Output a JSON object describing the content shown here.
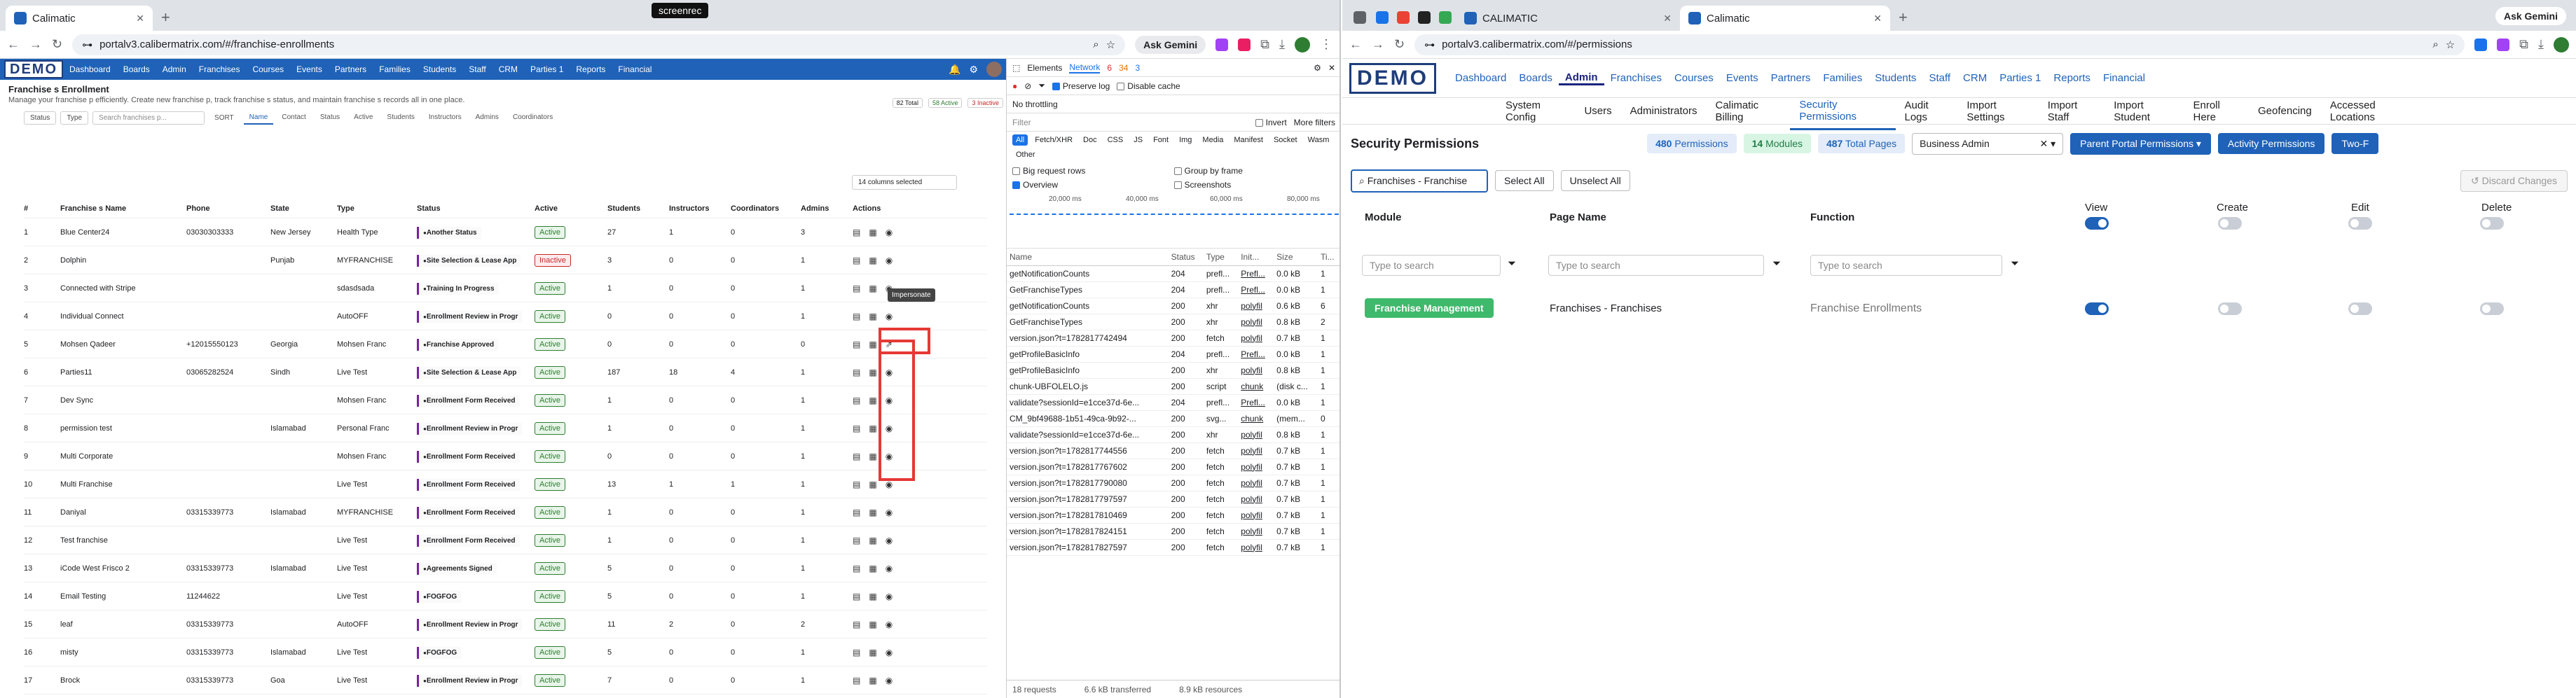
{
  "left": {
    "tab_title": "Calimatic",
    "recorder": "screenrec",
    "url": "portalv3.calibermatrix.com/#/franchise-enrollments",
    "ask_gemini": "Ask Gemini",
    "app": {
      "logo": "DEMO",
      "nav": [
        "Dashboard",
        "Boards",
        "Admin",
        "Franchises",
        "Courses",
        "Events",
        "Partners",
        "Families",
        "Students",
        "Staff",
        "CRM",
        "Parties 1",
        "Reports",
        "Financial"
      ]
    },
    "page": {
      "title": "Franchise s Enrollment",
      "subtitle": "Manage your franchise p efficiently. Create new franchise p, track franchise s status, and maintain franchise s records all in one place.",
      "badges": [
        "82 Total",
        "58 Active",
        "3 Inactive"
      ]
    },
    "filters": {
      "status": "Status",
      "type": "Type",
      "search_placeholder": "Search franchises p...",
      "sort": "SORT",
      "chips": [
        "Name",
        "Contact",
        "Status",
        "Active",
        "Students",
        "Instructors",
        "Admins",
        "Coordinators"
      ]
    },
    "columns_selected": "14 columns selected",
    "table": {
      "headers": [
        "#",
        "Franchise s Name",
        "Phone",
        "State",
        "Type",
        "Status",
        "Active",
        "Students",
        "Instructors",
        "Coordinators",
        "Admins",
        "Actions"
      ],
      "rows": [
        [
          "1",
          "Blue Center24",
          "03030303333",
          "New Jersey",
          "Health Type",
          "Another Status",
          "Active",
          "27",
          "1",
          "0",
          "3"
        ],
        [
          "2",
          "Dolphin",
          "",
          "Punjab",
          "MYFRANCHISE",
          "Site Selection & Lease App",
          "Inactive",
          "3",
          "0",
          "0",
          "1"
        ],
        [
          "3",
          "Connected with Stripe",
          "",
          "",
          "sdasdsada",
          "Training In Progress",
          "Active",
          "1",
          "0",
          "0",
          "1"
        ],
        [
          "4",
          "Individual Connect",
          "",
          "",
          "AutoOFF",
          "Enrollment Review in Progr",
          "Active",
          "0",
          "0",
          "0",
          "1"
        ],
        [
          "5",
          "Mohsen Qadeer",
          "+12015550123",
          "Georgia",
          "Mohsen Franc",
          "Franchise Approved",
          "Active",
          "0",
          "0",
          "0",
          "0"
        ],
        [
          "6",
          "Parties11",
          "03065282524",
          "Sindh",
          "Live Test",
          "Site Selection & Lease App",
          "Active",
          "187",
          "18",
          "4",
          "1"
        ],
        [
          "7",
          "Dev Sync",
          "",
          "",
          "Mohsen Franc",
          "Enrollment Form Received",
          "Active",
          "1",
          "0",
          "0",
          "1"
        ],
        [
          "8",
          "permission test",
          "",
          "Islamabad",
          "Personal Franc",
          "Enrollment Review in Progr",
          "Active",
          "1",
          "0",
          "0",
          "1"
        ],
        [
          "9",
          "Multi Corporate",
          "",
          "",
          "Mohsen Franc",
          "Enrollment Form Received",
          "Active",
          "0",
          "0",
          "0",
          "1"
        ],
        [
          "10",
          "Multi Franchise",
          "",
          "",
          "Live Test",
          "Enrollment Form Received",
          "Active",
          "13",
          "1",
          "1",
          "1"
        ],
        [
          "11",
          "Daniyal",
          "03315339773",
          "Islamabad",
          "MYFRANCHISE",
          "Enrollment Form Received",
          "Active",
          "1",
          "0",
          "0",
          "1"
        ],
        [
          "12",
          "Test franchise",
          "",
          "",
          "Live Test",
          "Enrollment Form Received",
          "Active",
          "1",
          "0",
          "0",
          "1"
        ],
        [
          "13",
          "iCode West Frisco 2",
          "03315339773",
          "Islamabad",
          "Live Test",
          "Agreements Signed",
          "Active",
          "5",
          "0",
          "0",
          "1"
        ],
        [
          "14",
          "Email Testing",
          "11244622",
          "",
          "Live Test",
          "FOGFOG",
          "Active",
          "5",
          "0",
          "0",
          "1"
        ],
        [
          "15",
          "leaf",
          "03315339773",
          "",
          "AutoOFF",
          "Enrollment Review in Progr",
          "Active",
          "11",
          "2",
          "0",
          "2"
        ],
        [
          "16",
          "misty",
          "03315339773",
          "Islamabad",
          "Live Test",
          "FOGFOG",
          "Active",
          "5",
          "0",
          "0",
          "1"
        ],
        [
          "17",
          "Brock",
          "03315339773",
          "Goa",
          "Live Test",
          "Enrollment Review in Progr",
          "Active",
          "7",
          "0",
          "0",
          "1"
        ]
      ]
    },
    "tooltip": "Impersonate",
    "devtools": {
      "tabs": [
        "Elements",
        "Network"
      ],
      "counts": [
        "6",
        "34",
        "3"
      ],
      "preserve_log": "Preserve log",
      "disable_cache": "Disable cache",
      "throttling": "No throttling",
      "filter_placeholder": "Filter",
      "invert": "Invert",
      "more_filters": "More filters",
      "types": [
        "All",
        "Fetch/XHR",
        "Doc",
        "CSS",
        "JS",
        "Font",
        "Img",
        "Media",
        "Manifest",
        "Socket",
        "Wasm",
        "Other"
      ],
      "opts": [
        "Big request rows",
        "Group by frame",
        "Overview",
        "Screenshots"
      ],
      "timeline": [
        "20,000 ms",
        "40,000 ms",
        "60,000 ms",
        "80,000 ms"
      ],
      "headers": [
        "Name",
        "Status",
        "Type",
        "Init...",
        "Size",
        "Ti..."
      ],
      "rows": [
        [
          "getNotificationCounts",
          "204",
          "prefl...",
          "Prefl...",
          "0.0 kB",
          "1"
        ],
        [
          "GetFranchiseTypes",
          "204",
          "prefl...",
          "Prefl...",
          "0.0 kB",
          "1"
        ],
        [
          "getNotificationCounts",
          "200",
          "xhr",
          "polyfil",
          "0.6 kB",
          "6"
        ],
        [
          "GetFranchiseTypes",
          "200",
          "xhr",
          "polyfil",
          "0.8 kB",
          "2"
        ],
        [
          "version.json?t=1782817742494",
          "200",
          "fetch",
          "polyfil",
          "0.7 kB",
          "1"
        ],
        [
          "getProfileBasicInfo",
          "204",
          "prefl...",
          "Prefl...",
          "0.0 kB",
          "1"
        ],
        [
          "getProfileBasicInfo",
          "200",
          "xhr",
          "polyfil",
          "0.8 kB",
          "1"
        ],
        [
          "chunk-UBFOLELO.js",
          "200",
          "script",
          "chunk",
          "(disk c...",
          "1"
        ],
        [
          "validate?sessionId=e1cce37d-6e...",
          "204",
          "prefl...",
          "Prefl...",
          "0.0 kB",
          "1"
        ],
        [
          "CM_9bf49688-1b51-49ca-9b92-...",
          "200",
          "svg...",
          "chunk",
          "(mem...",
          "0"
        ],
        [
          "validate?sessionId=e1cce37d-6e...",
          "200",
          "xhr",
          "polyfil",
          "0.8 kB",
          "1"
        ],
        [
          "version.json?t=1782817744556",
          "200",
          "fetch",
          "polyfil",
          "0.7 kB",
          "1"
        ],
        [
          "version.json?t=1782817767602",
          "200",
          "fetch",
          "polyfil",
          "0.7 kB",
          "1"
        ],
        [
          "version.json?t=1782817790080",
          "200",
          "fetch",
          "polyfil",
          "0.7 kB",
          "1"
        ],
        [
          "version.json?t=1782817797597",
          "200",
          "fetch",
          "polyfil",
          "0.7 kB",
          "1"
        ],
        [
          "version.json?t=1782817810469",
          "200",
          "fetch",
          "polyfil",
          "0.7 kB",
          "1"
        ],
        [
          "version.json?t=1782817824151",
          "200",
          "fetch",
          "polyfil",
          "0.7 kB",
          "1"
        ],
        [
          "version.json?t=1782817827597",
          "200",
          "fetch",
          "polyfil",
          "0.7 kB",
          "1"
        ]
      ],
      "footer": [
        "18 requests",
        "6.6 kB transferred",
        "8.9 kB resources"
      ]
    }
  },
  "right": {
    "tabs": [
      "CALIMATIC",
      "Calimatic"
    ],
    "url": "portalv3.calibermatrix.com/#/permissions",
    "ask_gemini": "Ask Gemini",
    "app": {
      "logo": "DEMO",
      "nav": [
        "Dashboard",
        "Boards",
        "Admin",
        "Franchises",
        "Courses",
        "Events",
        "Partners",
        "Families",
        "Students",
        "Staff",
        "CRM",
        "Parties 1",
        "Reports",
        "Financial"
      ]
    },
    "subnav": [
      "System Config",
      "Users",
      "Administrators",
      "Calimatic Billing",
      "Security Permissions",
      "Audit Logs",
      "Import Settings",
      "Import Staff",
      "Import Student",
      "Enroll Here",
      "Geofencing",
      "Accessed Locations"
    ],
    "title": "Security Permissions",
    "stats": [
      "480",
      "Permissions",
      "14",
      "Modules",
      "487",
      "Total Pages"
    ],
    "role": "Business Admin",
    "buttons": [
      "Parent Portal Permissions",
      "Activity Permissions",
      "Two-F"
    ],
    "search_value": "Franchises - Franchise",
    "select_all": "Select All",
    "unselect_all": "Unselect All",
    "discard": "Discard Changes",
    "cols": [
      "Module",
      "Page Name",
      "Function",
      "View",
      "Create",
      "Edit",
      "Delete"
    ],
    "type_to_search": "Type to search",
    "row": {
      "module": "Franchise Management",
      "page": "Franchises - Franchises",
      "function": "Franchise Enrollments"
    }
  }
}
